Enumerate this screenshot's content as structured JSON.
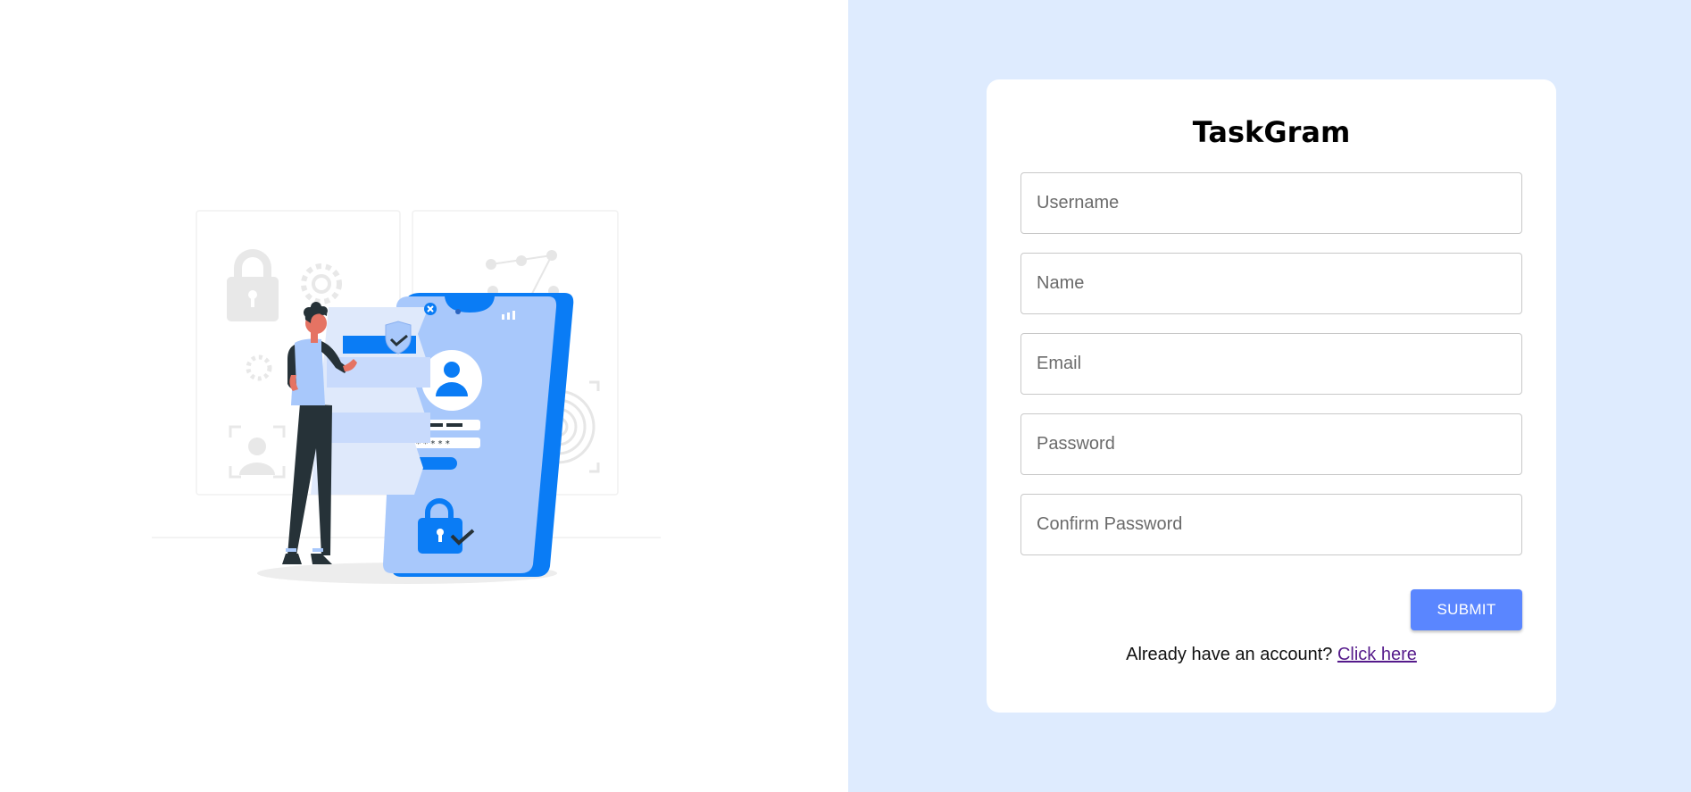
{
  "app": {
    "title": "TaskGram"
  },
  "form": {
    "fields": [
      {
        "placeholder": "Username",
        "value": ""
      },
      {
        "placeholder": "Name",
        "value": ""
      },
      {
        "placeholder": "Email",
        "value": ""
      },
      {
        "placeholder": "Password",
        "value": ""
      },
      {
        "placeholder": "Confirm Password",
        "value": ""
      }
    ],
    "submit_label": "SUBMIT",
    "login_prompt": "Already have an account?",
    "login_link": "Click here"
  },
  "colors": {
    "right_background": "#deebfe",
    "accent": "#5a86ff",
    "illustration_blue": "#0a7cf5",
    "illustration_light_blue": "#a8c8fb"
  },
  "illustration": {
    "subject": "person-unlocking-phone-with-password"
  }
}
